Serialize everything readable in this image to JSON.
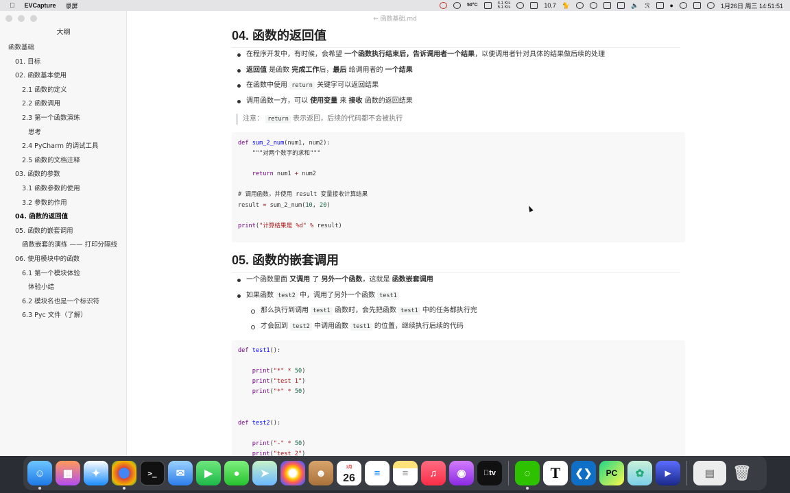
{
  "menubar": {
    "app_name": "EVCapture",
    "menu_item": "录屏",
    "cpu_temp": "50°C",
    "net_up": "4.1 K/s",
    "net_down": "5.1 K/s",
    "battery_text": "10.7",
    "datetime": "1月26日 周三  14:51:51"
  },
  "window": {
    "title": "函数基础.md"
  },
  "sidebar": {
    "title": "大纲",
    "items": [
      {
        "label": "函数基础",
        "level": 0,
        "active": false
      },
      {
        "label": "01. 目标",
        "level": 1,
        "active": false
      },
      {
        "label": "02. 函数基本使用",
        "level": 1,
        "active": false
      },
      {
        "label": "2.1 函数的定义",
        "level": 2,
        "active": false
      },
      {
        "label": "2.2 函数调用",
        "level": 2,
        "active": false
      },
      {
        "label": "2.3 第一个函数演练",
        "level": 2,
        "active": false
      },
      {
        "label": "思考",
        "level": 3,
        "active": false
      },
      {
        "label": "2.4 PyCharm 的调试工具",
        "level": 2,
        "active": false
      },
      {
        "label": "2.5 函数的文档注释",
        "level": 2,
        "active": false
      },
      {
        "label": "03. 函数的参数",
        "level": 1,
        "active": false
      },
      {
        "label": "3.1 函数参数的使用",
        "level": 2,
        "active": false
      },
      {
        "label": "3.2 参数的作用",
        "level": 2,
        "active": false
      },
      {
        "label": "04. 函数的返回值",
        "level": 1,
        "active": true
      },
      {
        "label": "05. 函数的嵌套调用",
        "level": 1,
        "active": false
      },
      {
        "label": "函数嵌套的演练 —— 打印分隔线",
        "level": 2,
        "active": false
      },
      {
        "label": "06. 使用模块中的函数",
        "level": 1,
        "active": false
      },
      {
        "label": "6.1 第一个模块体验",
        "level": 2,
        "active": false
      },
      {
        "label": "体验小结",
        "level": 3,
        "active": false
      },
      {
        "label": "6.2 模块名也是一个标识符",
        "level": 2,
        "active": false
      },
      {
        "label": "6.3 Pyc 文件（了解）",
        "level": 2,
        "active": false
      }
    ]
  },
  "section04": {
    "heading": "04. 函数的返回值",
    "b1": {
      "t1": "在程序开发中，有时候，会希望 ",
      "bold": "一个函数执行结束后，告诉调用者一个结果",
      "t2": "，以便调用者针对具体的结果做后续的处理"
    },
    "b2": {
      "bold1": "返回值",
      "t1": " 是函数 ",
      "bold2": "完成工作",
      "t2": "后，",
      "bold3": "最后",
      "t3": " 给调用者的 ",
      "bold4": "一个结果"
    },
    "b3": {
      "t1": "在函数中使用 ",
      "code": "return",
      "t2": " 关键字可以返回结果"
    },
    "b4": {
      "t1": "调用函数一方，可以 ",
      "bold1": "使用变量",
      "t2": " 来 ",
      "bold2": "接收",
      "t3": " 函数的返回结果"
    },
    "note": {
      "t1": "注意：",
      "code": "return",
      "t2": " 表示返回，后续的代码都不会被执行"
    },
    "code": {
      "l1_kw": "def",
      "l1_fn": "sum_2_num",
      "l1_rest": "(num1, num2):",
      "l2_doc": "    \"\"\"对两个数字的求和\"\"\"",
      "l4_kw": "    return",
      "l4_rest": " num1 ",
      "l4_op": "+",
      "l4_rest2": " num2",
      "l6_cm": "# 调用函数，并使用 result 变量接收计算结果",
      "l7_a": "result ",
      "l7_op": "=",
      "l7_b": " sum_2_num(",
      "l7_n1": "10",
      "l7_c": ", ",
      "l7_n2": "20",
      "l7_d": ")",
      "l9_kw": "print",
      "l9_a": "(",
      "l9_st": "\"计算结果是 %d\"",
      "l9_op": " % ",
      "l9_b": "result)"
    }
  },
  "section05": {
    "heading": "05. 函数的嵌套调用",
    "b1": {
      "t1": "一个函数里面 ",
      "bold1": "又调用",
      "t2": " 了 ",
      "bold2": "另外一个函数",
      "t3": "，这就是 ",
      "bold3": "函数嵌套调用"
    },
    "b2": {
      "t1": "如果函数 ",
      "code1": "test2",
      "t2": " 中，调用了另外一个函数 ",
      "code2": "test1"
    },
    "s1": {
      "t1": "那么执行到调用 ",
      "code1": "test1",
      "t2": " 函数时，会先把函数 ",
      "code2": "test1",
      "t3": " 中的任务都执行完"
    },
    "s2": {
      "t1": "才会回到 ",
      "code1": "test2",
      "t2": " 中调用函数 ",
      "code2": "test1",
      "t3": " 的位置，继续执行后续的代码"
    },
    "code": {
      "l1_kw": "def",
      "l1_fn": "test1",
      "l1_rest": "():",
      "l3_kw": "    print",
      "l3_a": "(",
      "l3_st": "\"*\"",
      "l3_op": " * ",
      "l3_n": "50",
      "l3_b": ")",
      "l4_kw": "    print",
      "l4_a": "(",
      "l4_st": "\"test 1\"",
      "l4_b": ")",
      "l5_kw": "    print",
      "l5_a": "(",
      "l5_st": "\"*\"",
      "l5_op": " * ",
      "l5_n": "50",
      "l5_b": ")",
      "l8_kw": "def",
      "l8_fn": "test2",
      "l8_rest": "():",
      "l10_kw": "    print",
      "l10_a": "(",
      "l10_st": "\"-\"",
      "l10_op": " * ",
      "l10_n": "50",
      "l10_b": ")",
      "l11_kw": "    print",
      "l11_a": "(",
      "l11_st": "\"test 2\"",
      "l11_b": ")"
    }
  },
  "dock": {
    "calendar_month": "1月",
    "calendar_day": "26",
    "appletv_label": "tv",
    "typora_label": "T",
    "pycharm_label": "PC",
    "terminal_label": ">_",
    "apps": [
      "finder",
      "launchpad",
      "safari",
      "chrome",
      "terminal",
      "mail",
      "facetime",
      "messages",
      "maps",
      "photos",
      "contacts",
      "calendar",
      "reminders",
      "notes",
      "music",
      "podcasts",
      "appletv",
      "wechat",
      "typora",
      "vscode",
      "pycharm",
      "evcapture",
      "screen-recorder",
      "downloads",
      "trash"
    ]
  },
  "colors": {
    "accent_keyword": "#770088",
    "function": "#0000ff",
    "string": "#aa1111",
    "number": "#116644",
    "comment": "#aa5500"
  }
}
